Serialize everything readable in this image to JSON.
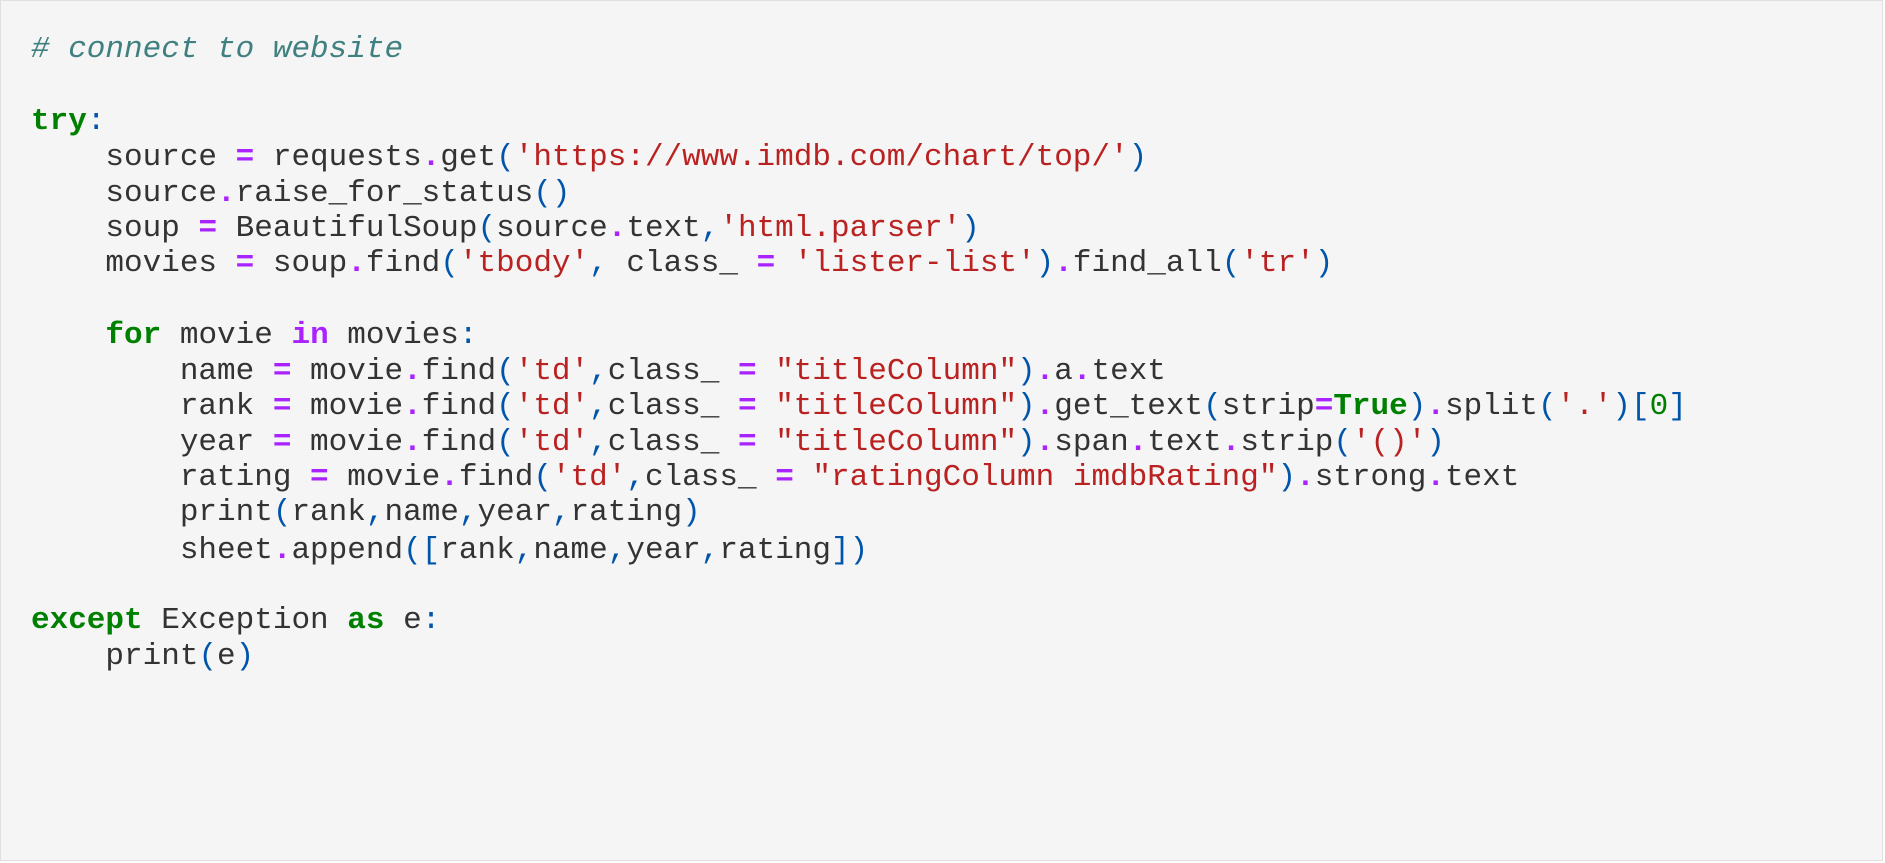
{
  "code_cell": {
    "lines": [
      [
        {
          "t": "cm",
          "v": "# connect to website"
        }
      ],
      [],
      [
        {
          "t": "kw",
          "v": "try"
        },
        {
          "t": "p",
          "v": ":"
        }
      ],
      [
        {
          "t": "id",
          "v": "    source "
        },
        {
          "t": "op",
          "v": "="
        },
        {
          "t": "id",
          "v": " requests"
        },
        {
          "t": "op",
          "v": "."
        },
        {
          "t": "id",
          "v": "get"
        },
        {
          "t": "p",
          "v": "("
        },
        {
          "t": "str",
          "v": "'https://www.imdb.com/chart/top/'"
        },
        {
          "t": "p",
          "v": ")"
        }
      ],
      [
        {
          "t": "id",
          "v": "    source"
        },
        {
          "t": "op",
          "v": "."
        },
        {
          "t": "id",
          "v": "raise_for_status"
        },
        {
          "t": "p",
          "v": "()"
        }
      ],
      [
        {
          "t": "id",
          "v": "    soup "
        },
        {
          "t": "op",
          "v": "="
        },
        {
          "t": "id",
          "v": " BeautifulSoup"
        },
        {
          "t": "p",
          "v": "("
        },
        {
          "t": "id",
          "v": "source"
        },
        {
          "t": "op",
          "v": "."
        },
        {
          "t": "id",
          "v": "text"
        },
        {
          "t": "p",
          "v": ","
        },
        {
          "t": "str",
          "v": "'html.parser'"
        },
        {
          "t": "p",
          "v": ")"
        }
      ],
      [
        {
          "t": "id",
          "v": "    movies "
        },
        {
          "t": "op",
          "v": "="
        },
        {
          "t": "id",
          "v": " soup"
        },
        {
          "t": "op",
          "v": "."
        },
        {
          "t": "id",
          "v": "find"
        },
        {
          "t": "p",
          "v": "("
        },
        {
          "t": "str",
          "v": "'tbody'"
        },
        {
          "t": "p",
          "v": ", "
        },
        {
          "t": "id",
          "v": "class_ "
        },
        {
          "t": "op",
          "v": "="
        },
        {
          "t": "id",
          "v": " "
        },
        {
          "t": "str",
          "v": "'lister-list'"
        },
        {
          "t": "p",
          "v": ")"
        },
        {
          "t": "op",
          "v": "."
        },
        {
          "t": "id",
          "v": "find_all"
        },
        {
          "t": "p",
          "v": "("
        },
        {
          "t": "str",
          "v": "'tr'"
        },
        {
          "t": "p",
          "v": ")"
        }
      ],
      [],
      [
        {
          "t": "id",
          "v": "    "
        },
        {
          "t": "kw",
          "v": "for"
        },
        {
          "t": "id",
          "v": " movie "
        },
        {
          "t": "kw2",
          "v": "in"
        },
        {
          "t": "id",
          "v": " movies"
        },
        {
          "t": "p",
          "v": ":"
        }
      ],
      [
        {
          "t": "id",
          "v": "        name "
        },
        {
          "t": "op",
          "v": "="
        },
        {
          "t": "id",
          "v": " movie"
        },
        {
          "t": "op",
          "v": "."
        },
        {
          "t": "id",
          "v": "find"
        },
        {
          "t": "p",
          "v": "("
        },
        {
          "t": "str",
          "v": "'td'"
        },
        {
          "t": "p",
          "v": ","
        },
        {
          "t": "id",
          "v": "class_ "
        },
        {
          "t": "op",
          "v": "="
        },
        {
          "t": "id",
          "v": " "
        },
        {
          "t": "str",
          "v": "\"titleColumn\""
        },
        {
          "t": "p",
          "v": ")"
        },
        {
          "t": "op",
          "v": "."
        },
        {
          "t": "id",
          "v": "a"
        },
        {
          "t": "op",
          "v": "."
        },
        {
          "t": "id",
          "v": "text"
        }
      ],
      [
        {
          "t": "id",
          "v": "        rank "
        },
        {
          "t": "op",
          "v": "="
        },
        {
          "t": "id",
          "v": " movie"
        },
        {
          "t": "op",
          "v": "."
        },
        {
          "t": "id",
          "v": "find"
        },
        {
          "t": "p",
          "v": "("
        },
        {
          "t": "str",
          "v": "'td'"
        },
        {
          "t": "p",
          "v": ","
        },
        {
          "t": "id",
          "v": "class_ "
        },
        {
          "t": "op",
          "v": "="
        },
        {
          "t": "id",
          "v": " "
        },
        {
          "t": "str",
          "v": "\"titleColumn\""
        },
        {
          "t": "p",
          "v": ")"
        },
        {
          "t": "op",
          "v": "."
        },
        {
          "t": "id",
          "v": "get_text"
        },
        {
          "t": "p",
          "v": "("
        },
        {
          "t": "id",
          "v": "strip"
        },
        {
          "t": "op",
          "v": "="
        },
        {
          "t": "bool",
          "v": "True"
        },
        {
          "t": "p",
          "v": ")"
        },
        {
          "t": "op",
          "v": "."
        },
        {
          "t": "id",
          "v": "split"
        },
        {
          "t": "p",
          "v": "("
        },
        {
          "t": "str",
          "v": "'.'"
        },
        {
          "t": "p",
          "v": ")["
        },
        {
          "t": "num",
          "v": "0"
        },
        {
          "t": "p",
          "v": "]"
        }
      ],
      [
        {
          "t": "id",
          "v": "        year "
        },
        {
          "t": "op",
          "v": "="
        },
        {
          "t": "id",
          "v": " movie"
        },
        {
          "t": "op",
          "v": "."
        },
        {
          "t": "id",
          "v": "find"
        },
        {
          "t": "p",
          "v": "("
        },
        {
          "t": "str",
          "v": "'td'"
        },
        {
          "t": "p",
          "v": ","
        },
        {
          "t": "id",
          "v": "class_ "
        },
        {
          "t": "op",
          "v": "="
        },
        {
          "t": "id",
          "v": " "
        },
        {
          "t": "str",
          "v": "\"titleColumn\""
        },
        {
          "t": "p",
          "v": ")"
        },
        {
          "t": "op",
          "v": "."
        },
        {
          "t": "id",
          "v": "span"
        },
        {
          "t": "op",
          "v": "."
        },
        {
          "t": "id",
          "v": "text"
        },
        {
          "t": "op",
          "v": "."
        },
        {
          "t": "id",
          "v": "strip"
        },
        {
          "t": "p",
          "v": "("
        },
        {
          "t": "str",
          "v": "'()'"
        },
        {
          "t": "p",
          "v": ")"
        }
      ],
      [
        {
          "t": "id",
          "v": "        rating "
        },
        {
          "t": "op",
          "v": "="
        },
        {
          "t": "id",
          "v": " movie"
        },
        {
          "t": "op",
          "v": "."
        },
        {
          "t": "id",
          "v": "find"
        },
        {
          "t": "p",
          "v": "("
        },
        {
          "t": "str",
          "v": "'td'"
        },
        {
          "t": "p",
          "v": ","
        },
        {
          "t": "id",
          "v": "class_ "
        },
        {
          "t": "op",
          "v": "="
        },
        {
          "t": "id",
          "v": " "
        },
        {
          "t": "str",
          "v": "\"ratingColumn imdbRating\""
        },
        {
          "t": "p",
          "v": ")"
        },
        {
          "t": "op",
          "v": "."
        },
        {
          "t": "id",
          "v": "strong"
        },
        {
          "t": "op",
          "v": "."
        },
        {
          "t": "id",
          "v": "text"
        }
      ],
      [
        {
          "t": "id",
          "v": "        print"
        },
        {
          "t": "p",
          "v": "("
        },
        {
          "t": "id",
          "v": "rank"
        },
        {
          "t": "p",
          "v": ","
        },
        {
          "t": "id",
          "v": "name"
        },
        {
          "t": "p",
          "v": ","
        },
        {
          "t": "id",
          "v": "year"
        },
        {
          "t": "p",
          "v": ","
        },
        {
          "t": "id",
          "v": "rating"
        },
        {
          "t": "p",
          "v": ")"
        }
      ],
      [
        {
          "t": "id",
          "v": "        sheet"
        },
        {
          "t": "op",
          "v": "."
        },
        {
          "t": "id",
          "v": "append"
        },
        {
          "t": "p",
          "v": "(["
        },
        {
          "t": "id",
          "v": "rank"
        },
        {
          "t": "p",
          "v": ","
        },
        {
          "t": "id",
          "v": "name"
        },
        {
          "t": "p",
          "v": ","
        },
        {
          "t": "id",
          "v": "year"
        },
        {
          "t": "p",
          "v": ","
        },
        {
          "t": "id",
          "v": "rating"
        },
        {
          "t": "p",
          "v": "])"
        }
      ],
      [],
      [
        {
          "t": "kw",
          "v": "except"
        },
        {
          "t": "id",
          "v": " Exception "
        },
        {
          "t": "kw",
          "v": "as"
        },
        {
          "t": "id",
          "v": " e"
        },
        {
          "t": "p",
          "v": ":"
        }
      ],
      [
        {
          "t": "id",
          "v": "    print"
        },
        {
          "t": "p",
          "v": "("
        },
        {
          "t": "id",
          "v": "e"
        },
        {
          "t": "p",
          "v": ")"
        }
      ]
    ]
  },
  "colors": {
    "background": "#f5f5f5",
    "keyword": "#008000",
    "operator": "#aa22ff",
    "string": "#ba2121",
    "comment": "#408080",
    "punctuation": "#0055aa",
    "identifier": "#333333"
  }
}
